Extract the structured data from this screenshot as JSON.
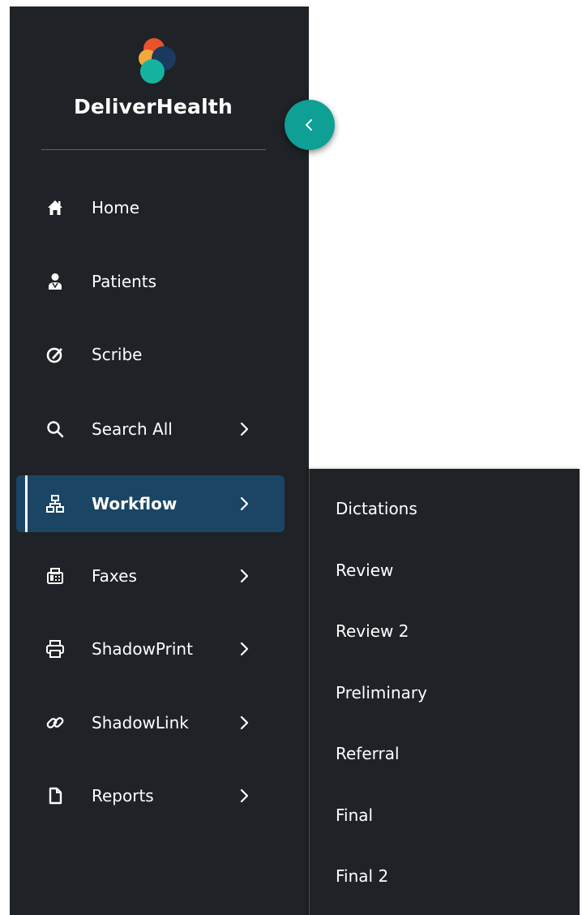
{
  "brand": {
    "name": "DeliverHealth",
    "logo_colors": [
      "#e8532c",
      "#f2a83b",
      "#1a3a5e",
      "#15b3a0"
    ]
  },
  "collapse_button": {
    "icon": "chevron-left-icon",
    "color": "#0e9f95"
  },
  "sidebar": {
    "background": "#1f2226",
    "active_background": "#1b4565",
    "items": [
      {
        "label": "Home",
        "icon": "home-icon",
        "has_submenu": false,
        "active": false
      },
      {
        "label": "Patients",
        "icon": "patient-icon",
        "has_submenu": false,
        "active": false
      },
      {
        "label": "Scribe",
        "icon": "scribe-icon",
        "has_submenu": false,
        "active": false
      },
      {
        "label": "Search All",
        "icon": "search-icon",
        "has_submenu": true,
        "active": false
      },
      {
        "label": "Workflow",
        "icon": "workflow-icon",
        "has_submenu": true,
        "active": true
      },
      {
        "label": "Faxes",
        "icon": "fax-icon",
        "has_submenu": true,
        "active": false
      },
      {
        "label": "ShadowPrint",
        "icon": "printer-icon",
        "has_submenu": true,
        "active": false
      },
      {
        "label": "ShadowLink",
        "icon": "link-icon",
        "has_submenu": true,
        "active": false
      },
      {
        "label": "Reports",
        "icon": "document-icon",
        "has_submenu": true,
        "active": false
      }
    ]
  },
  "submenu": {
    "parent": "Workflow",
    "items": [
      "Dictations",
      "Review",
      "Review 2",
      "Preliminary",
      "Referral",
      "Final",
      "Final 2"
    ]
  }
}
